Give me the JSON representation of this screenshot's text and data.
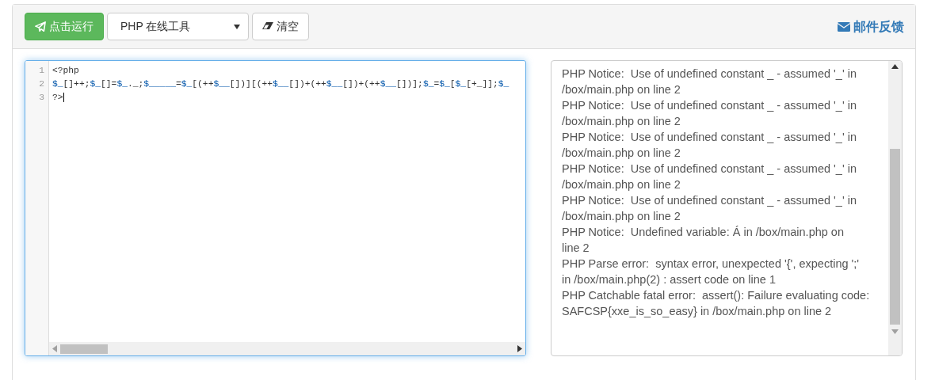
{
  "toolbar": {
    "run_button": "点击运行",
    "language_select": "PHP 在线工具",
    "clear_button": "清空",
    "feedback_link": "邮件反馈"
  },
  "editor": {
    "lines": [
      {
        "number": "1",
        "tokens": [
          {
            "kind": "plain",
            "text": "<?php"
          }
        ]
      },
      {
        "number": "2",
        "tokens": [
          {
            "kind": "var",
            "text": "$_"
          },
          {
            "kind": "plain",
            "text": "[]++;"
          },
          {
            "kind": "var",
            "text": "$_"
          },
          {
            "kind": "plain",
            "text": "[]="
          },
          {
            "kind": "var",
            "text": "$_"
          },
          {
            "kind": "plain",
            "text": "._;"
          },
          {
            "kind": "var",
            "text": "$_____"
          },
          {
            "kind": "plain",
            "text": "="
          },
          {
            "kind": "var",
            "text": "$_"
          },
          {
            "kind": "plain",
            "text": "[(++"
          },
          {
            "kind": "var",
            "text": "$__"
          },
          {
            "kind": "plain",
            "text": "[])][(++"
          },
          {
            "kind": "var",
            "text": "$__"
          },
          {
            "kind": "plain",
            "text": "[])+(++"
          },
          {
            "kind": "var",
            "text": "$__"
          },
          {
            "kind": "plain",
            "text": "[])+(++"
          },
          {
            "kind": "var",
            "text": "$__"
          },
          {
            "kind": "plain",
            "text": "[])];"
          },
          {
            "kind": "var",
            "text": "$_"
          },
          {
            "kind": "plain",
            "text": "="
          },
          {
            "kind": "var",
            "text": "$_"
          },
          {
            "kind": "plain",
            "text": "["
          },
          {
            "kind": "var",
            "text": "$_"
          },
          {
            "kind": "plain",
            "text": "[+_]];"
          },
          {
            "kind": "var",
            "text": "$_"
          }
        ]
      },
      {
        "number": "3",
        "tokens": [
          {
            "kind": "plain",
            "text": "?>"
          }
        ]
      }
    ]
  },
  "output": {
    "lines": [
      "PHP Notice:  Use of undefined constant _ - assumed '_' in",
      "/box/main.php on line 2",
      "PHP Notice:  Use of undefined constant _ - assumed '_' in",
      "/box/main.php on line 2",
      "PHP Notice:  Use of undefined constant _ - assumed '_' in",
      "/box/main.php on line 2",
      "PHP Notice:  Use of undefined constant _ - assumed '_' in",
      "/box/main.php on line 2",
      "PHP Notice:  Use of undefined constant _ - assumed '_' in",
      "/box/main.php on line 2",
      "PHP Notice:  Undefined variable: Á in /box/main.php on",
      "line 2",
      "PHP Parse error:  syntax error, unexpected '{', expecting ';'",
      "in /box/main.php(2) : assert code on line 1",
      "PHP Catchable fatal error:  assert(): Failure evaluating code:",
      "SAFCSP{xxe_is_so_easy} in /box/main.php on line 2"
    ]
  }
}
